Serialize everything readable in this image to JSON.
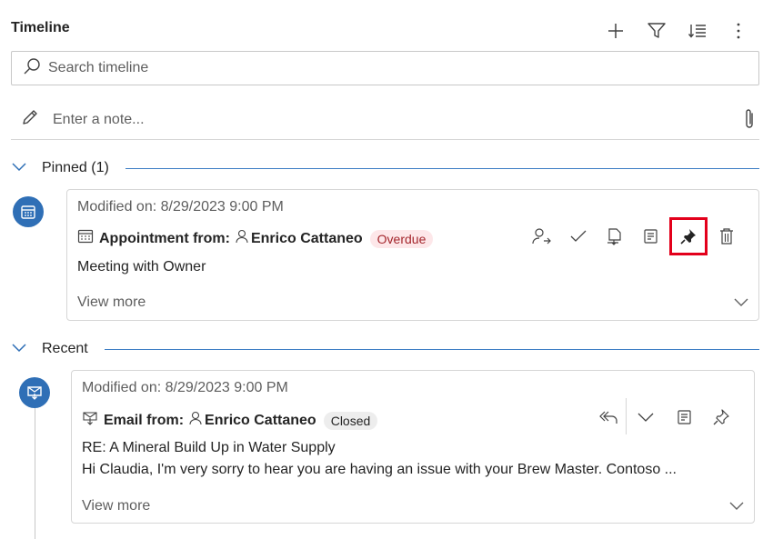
{
  "header": {
    "title": "Timeline",
    "icons": [
      "plus-icon",
      "filter-icon",
      "sort-icon",
      "more-icon"
    ]
  },
  "search": {
    "placeholder": "Search timeline"
  },
  "note": {
    "placeholder": "Enter a note..."
  },
  "pinned": {
    "label": "Pinned (1)",
    "item": {
      "modified": "Modified on: 8/29/2023 9:00 PM",
      "type_label": "Appointment from:",
      "person": "Enrico Cattaneo",
      "status": "Overdue",
      "description": "Meeting with Owner",
      "view_more": "View more",
      "actions": [
        "assign-icon",
        "complete-icon",
        "convert-icon",
        "note-icon",
        "pin-icon",
        "delete-icon"
      ]
    }
  },
  "recent": {
    "label": "Recent",
    "item": {
      "modified": "Modified on: 8/29/2023 9:00 PM",
      "type_label": "Email from:",
      "person": "Enrico Cattaneo",
      "status": "Closed",
      "subject": "RE: A Mineral Build Up in Water Supply",
      "preview": "Hi Claudia, I'm very sorry to hear you are having an issue with your Brew Master. Contoso ...",
      "view_more": "View more",
      "actions": [
        "reply-all-icon",
        "chevron-down-icon",
        "note-icon",
        "pin-icon"
      ]
    }
  },
  "colors": {
    "accent": "#2f6fb6",
    "overdue": "#a4262c",
    "highlight": "#e3001b"
  }
}
